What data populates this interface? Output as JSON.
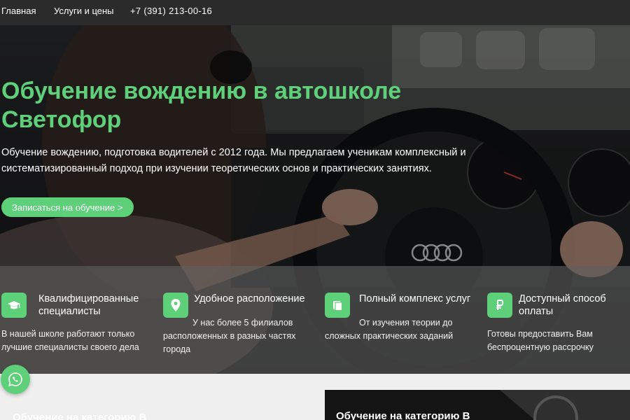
{
  "nav": {
    "home": "Главная",
    "services": "Услуги и цены",
    "phone": "+7 (391) 213-00-16"
  },
  "hero": {
    "title": "Обучение вождению в автошколе Светофор",
    "subtitle": "Обучение вождению, подготовка водителей с 2012 года. Мы предлагаем ученикам комплексный и систематизированный подход при изучении теоретических основ и практических занятиях.",
    "cta_label": "Записаться на обучение >"
  },
  "features": [
    {
      "icon": "graduation-cap-icon",
      "title": "Квалифицированные специалисты",
      "desc": "В нашей школе работают только лучшие специалисты своего дела"
    },
    {
      "icon": "location-pin-icon",
      "title": "Удобное расположение",
      "desc": "У нас более 5 филиалов расположенных в разных частях города"
    },
    {
      "icon": "book-icon",
      "title": "Полный комплекс услуг",
      "desc": "От изучения теории до сложных практических заданий"
    },
    {
      "icon": "ruble-icon",
      "title": "Доступный способ оплаты",
      "desc": "Готовы предоставить Вам беспроцентную рассрочку"
    }
  ],
  "cards": {
    "left_title": "Обучение на категорию B",
    "right_title": "Обучение на категорию B"
  },
  "floating": {
    "icon": "whatsapp-icon"
  },
  "colors": {
    "accent": "#5fd07a",
    "nav_bg": "#2b2b2b",
    "band_bg": "#5f5f5f"
  }
}
